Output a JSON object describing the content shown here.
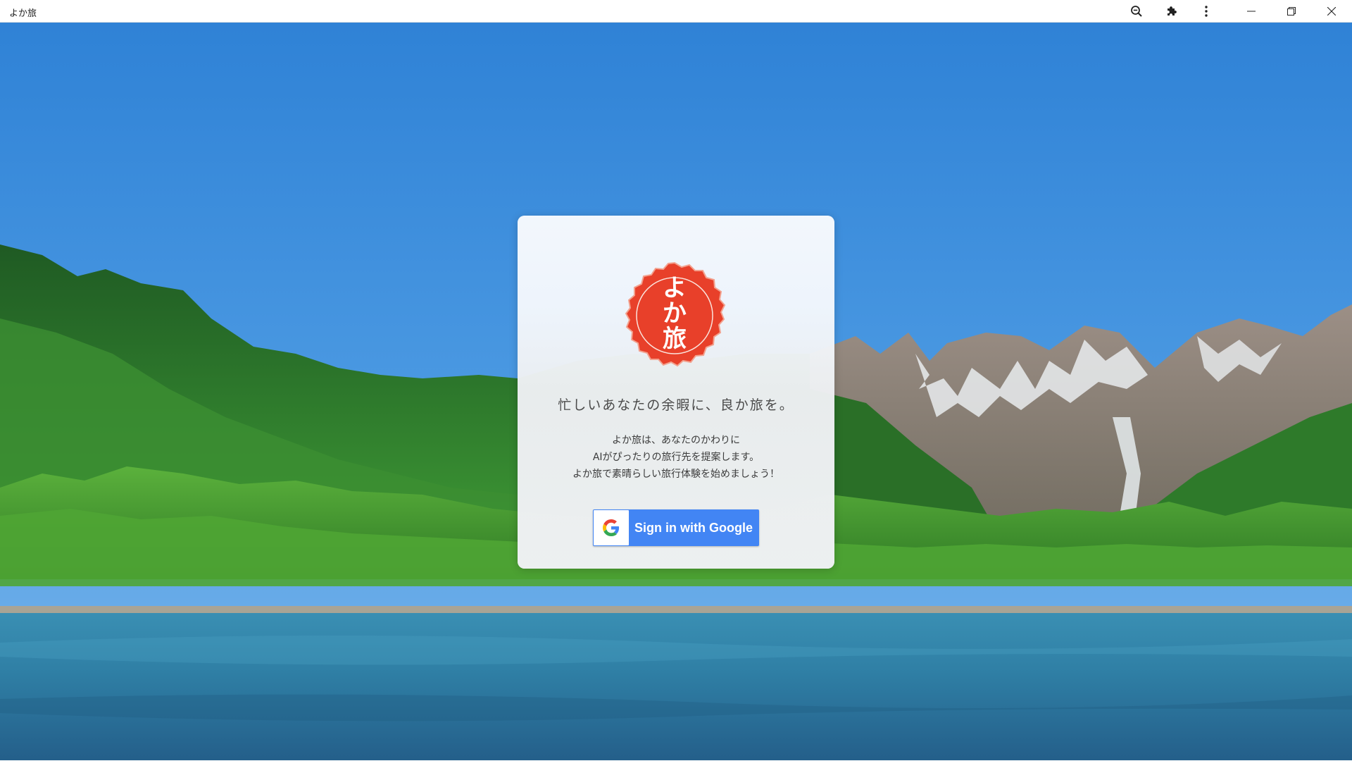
{
  "window": {
    "title": "よか旅",
    "toolbar_icons": [
      "zoom-out-icon",
      "extensions-icon",
      "more-icon"
    ],
    "controls": [
      "minimize-icon",
      "restore-icon",
      "close-icon"
    ]
  },
  "login_card": {
    "logo_text": "よか旅",
    "tagline": "忙しいあなたの余暇に、良か旅を。",
    "description": [
      "よか旅は、あなたのかわりに",
      "AIがぴったりの旅行先を提案します。",
      "よか旅で素晴らしい旅行体験を始めましょう！"
    ],
    "sign_in_button": "Sign in with Google"
  },
  "colors": {
    "seal_red": "#e8402a",
    "google_blue": "#4285f4",
    "sky_top": "#2f82d6",
    "lake": "#2f7fa5"
  }
}
